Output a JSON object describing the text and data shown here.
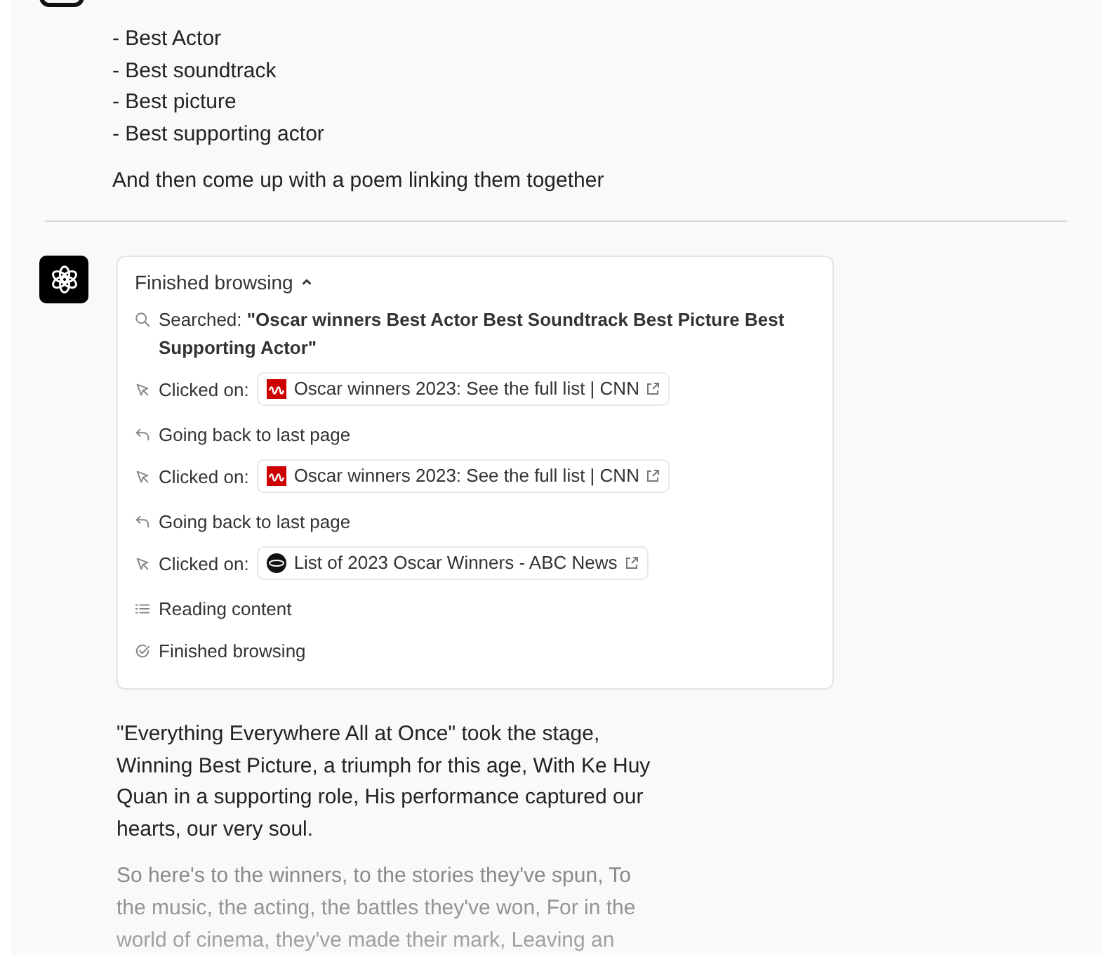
{
  "user_message": {
    "list_items": [
      "- Best Actor",
      "- Best soundtrack",
      "- Best picture",
      "- Best supporting actor"
    ],
    "closing": "And then come up with a poem linking them together"
  },
  "assistant": {
    "browsing": {
      "title": "Finished browsing",
      "expanded": true,
      "steps": [
        {
          "kind": "search",
          "label": "Searched:",
          "query": "\"Oscar winners Best Actor Best Soundtrack Best Picture Best Supporting Actor\""
        },
        {
          "kind": "click",
          "label": "Clicked on:",
          "link": {
            "title": "Oscar winners 2023: See the full list | CNN",
            "kind": "square"
          }
        },
        {
          "kind": "back",
          "label": "Going back to last page"
        },
        {
          "kind": "click",
          "label": "Clicked on:",
          "link": {
            "title": "Oscar winners 2023: See the full list | CNN",
            "kind": "square"
          }
        },
        {
          "kind": "back",
          "label": "Going back to last page"
        },
        {
          "kind": "click",
          "label": "Clicked on:",
          "link": {
            "title": "List of 2023 Oscar Winners - ABC News",
            "kind": "circle"
          }
        },
        {
          "kind": "read",
          "label": "Reading content"
        },
        {
          "kind": "done",
          "label": "Finished browsing"
        }
      ]
    },
    "poem": [
      {
        "text": "\"Everything Everywhere All at Once\" took the stage, Winning Best Picture, a triumph for this age, With Ke Huy Quan in a supporting role, His performance captured our hearts, our very soul.",
        "faded": false
      },
      {
        "text": "So here's to the winners, to the stories they've spun, To the music, the acting, the battles they've won, For in the world of cinema, they've made their mark, Leaving an",
        "faded": true
      }
    ]
  }
}
